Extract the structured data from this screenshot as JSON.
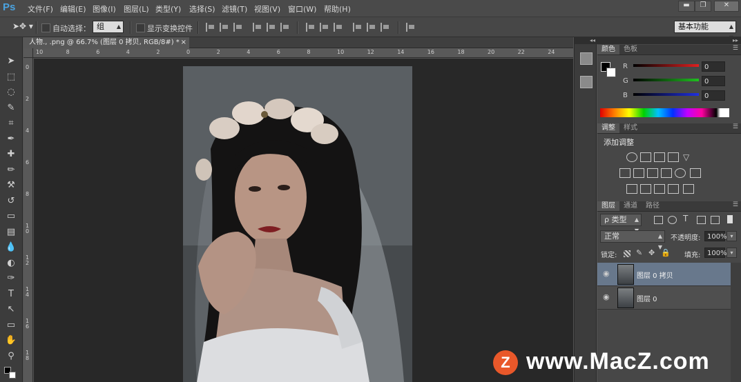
{
  "menubar": {
    "logo": "Ps",
    "items": [
      "文件(F)",
      "编辑(E)",
      "图像(I)",
      "图层(L)",
      "类型(Y)",
      "选择(S)",
      "滤镜(T)",
      "视图(V)",
      "窗口(W)",
      "帮助(H)"
    ],
    "window_buttons": [
      "▬",
      "❐",
      "✕"
    ]
  },
  "options": {
    "auto_select_label": "自动选择：",
    "auto_select_value": "组",
    "show_transform_label": "显示变换控件",
    "workspace": "基本功能"
  },
  "toolbox": {
    "icons": [
      "move-icon",
      "marquee-icon",
      "lasso-icon",
      "quick-select-icon",
      "crop-icon",
      "eyedropper-icon",
      "healing-brush-icon",
      "brush-icon",
      "clone-stamp-icon",
      "history-brush-icon",
      "eraser-icon",
      "gradient-icon",
      "blur-icon",
      "dodge-icon",
      "pen-icon",
      "type-icon",
      "path-select-icon",
      "rectangle-icon",
      "hand-icon",
      "zoom-icon"
    ],
    "glyphs": [
      "➤",
      "⬚",
      "◌",
      "✎",
      "⌗",
      "✒",
      "✚",
      "✏",
      "⚒",
      "↺",
      "▭",
      "▤",
      "💧",
      "◐",
      "✑",
      "T",
      "↖",
      "▭",
      "✋",
      "⚲"
    ]
  },
  "document": {
    "tab_title": "人物., .png @ 66.7% (图层 0 拷贝, RGB/8#) *",
    "tab_close": "×",
    "ruler_top": [
      "10",
      "8",
      "6",
      "4",
      "2",
      "0",
      "2",
      "4",
      "6",
      "8",
      "10",
      "12",
      "14",
      "16",
      "18",
      "20",
      "22",
      "24",
      "26",
      "28",
      "30"
    ],
    "ruler_left": [
      "0",
      "2",
      "4",
      "6",
      "8",
      "1\n0",
      "1\n2",
      "1\n4",
      "1\n6",
      "1\n8"
    ]
  },
  "color_panel": {
    "tabs": [
      "颜色",
      "色板"
    ],
    "channels": [
      {
        "label": "R",
        "value": "0",
        "color": "#d02020"
      },
      {
        "label": "G",
        "value": "0",
        "color": "#20b020"
      },
      {
        "label": "B",
        "value": "0",
        "color": "#2030d0"
      }
    ]
  },
  "adjust_panel": {
    "tabs": [
      "调整",
      "样式"
    ],
    "title": "添加调整"
  },
  "layers_panel": {
    "tabs": [
      "图层",
      "通道",
      "路径"
    ],
    "filter_label": "ρ 类型",
    "blend_mode": "正常",
    "opacity_label": "不透明度:",
    "opacity_value": "100%",
    "lock_label": "锁定:",
    "fill_label": "填充:",
    "fill_value": "100%",
    "layers": [
      {
        "name": "图层 0 拷贝",
        "selected": true
      },
      {
        "name": "图层 0",
        "selected": false
      }
    ]
  },
  "watermark": {
    "logo": "Z",
    "text": "www.MacZ.com"
  }
}
